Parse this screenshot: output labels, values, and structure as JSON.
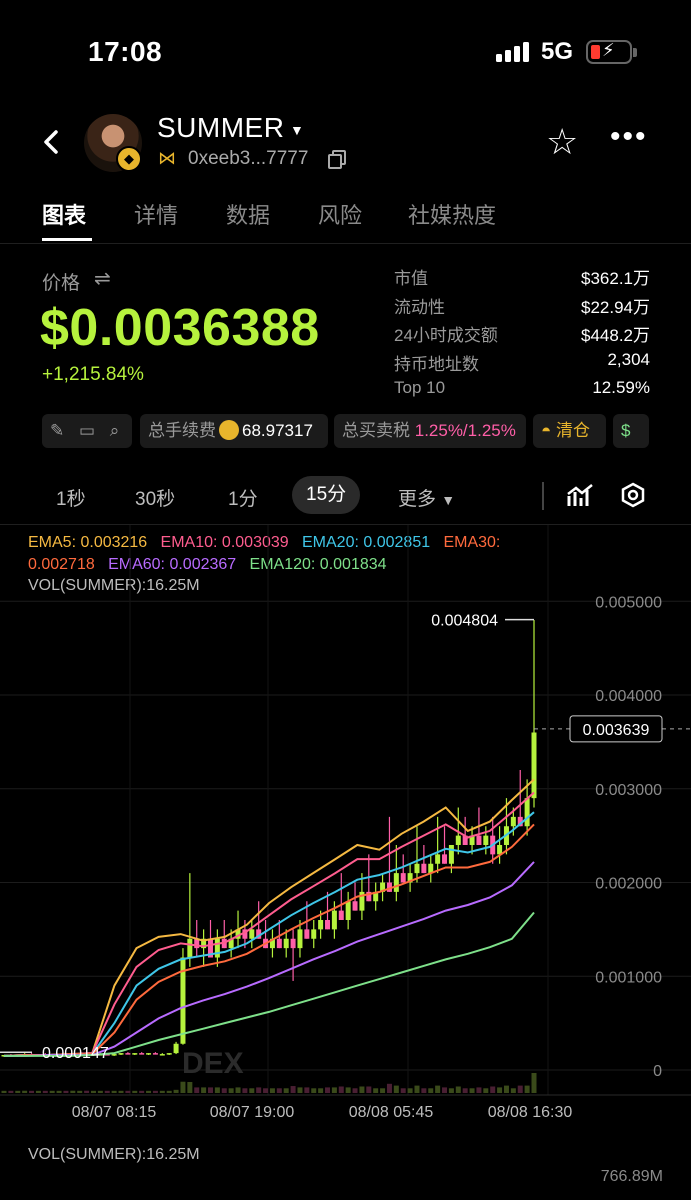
{
  "status_bar": {
    "time": "17:08",
    "network": "5G"
  },
  "header": {
    "token_name": "SUMMER",
    "address": "0xeeb3...7777",
    "icons": [
      "back-icon",
      "caret-down-icon",
      "chain-icon",
      "copy-icon",
      "star-icon",
      "more-icon"
    ]
  },
  "tabs": [
    "图表",
    "详情",
    "数据",
    "风险",
    "社媒热度"
  ],
  "price": {
    "label": "价格",
    "value": "$0.0036388",
    "change": "+1,215.84%"
  },
  "stats": [
    {
      "key": "市值",
      "value": "$362.1万"
    },
    {
      "key": "流动性",
      "value": "$22.94万"
    },
    {
      "key": "24小时成交额",
      "value": "$448.2万"
    },
    {
      "key": "持币地址数",
      "value": "2,304"
    },
    {
      "key": "Top 10",
      "value": "12.59%"
    }
  ],
  "chips": {
    "fee_label": "总手续费",
    "fee_value": "68.97317",
    "tax_label": "总买卖税",
    "tax_value": "1.25%/1.25%",
    "clear_label": "清仓"
  },
  "timeframes": [
    "1秒",
    "30秒",
    "1分",
    "15分",
    "更多"
  ],
  "active_timeframe": "15分",
  "ema": {
    "ema5_label": "EMA5:",
    "ema5": "0.003216",
    "ema10_label": "EMA10:",
    "ema10": "0.003039",
    "ema20_label": "EMA20:",
    "ema20": "0.002851",
    "ema30_label": "EMA30:",
    "ema30": "0.002718",
    "ema60_label": "EMA60:",
    "ema60": "0.002367",
    "ema120_label": "EMA120:",
    "ema120": "0.001834",
    "vol_line": "VOL(SUMMER):16.25M"
  },
  "colors": {
    "up": "#b6f23d",
    "down": "#ff5fa8",
    "ema5": "#f5b942",
    "ema10": "#ff5d8f",
    "ema20": "#3fc6e8",
    "ema30": "#ff6a3d",
    "ema60": "#b86bff",
    "ema120": "#7ee08a"
  },
  "chart_data": {
    "type": "candlestick",
    "y_ticks": [
      "0.005000",
      "0.004000",
      "0.003000",
      "0.002000",
      "0.001000",
      "0"
    ],
    "ylim": [
      0,
      0.0056
    ],
    "x_ticks": [
      "08/07 08:15",
      "08/07 19:00",
      "08/08 05:45",
      "08/08 16:30"
    ],
    "high_marker": "0.004804",
    "low_marker": "0.000147",
    "current_price_tag": "0.003639",
    "watermark": "DEX",
    "series": [
      {
        "name": "EMA5",
        "values": [
          0.00015,
          0.00016,
          0.00016,
          0.00017,
          0.00018,
          0.0009,
          0.0013,
          0.00142,
          0.00145,
          0.00138,
          0.00142,
          0.00155,
          0.00178,
          0.00195,
          0.0021,
          0.00225,
          0.0024,
          0.00235,
          0.00252,
          0.00265,
          0.0028,
          0.00255,
          0.00265,
          0.00288,
          0.0031
        ]
      },
      {
        "name": "EMA10",
        "values": [
          0.00015,
          0.00016,
          0.00016,
          0.00017,
          0.00018,
          0.0007,
          0.0011,
          0.00128,
          0.00135,
          0.00132,
          0.00136,
          0.00148,
          0.00165,
          0.00182,
          0.00196,
          0.0021,
          0.00225,
          0.00225,
          0.00238,
          0.0025,
          0.00262,
          0.00248,
          0.00255,
          0.00275,
          0.00296
        ]
      },
      {
        "name": "EMA20",
        "values": [
          0.00015,
          0.00016,
          0.00016,
          0.00017,
          0.00017,
          0.0005,
          0.0009,
          0.00108,
          0.00118,
          0.00122,
          0.00126,
          0.00135,
          0.0015,
          0.00165,
          0.00178,
          0.0019,
          0.00203,
          0.00208,
          0.00216,
          0.00226,
          0.00236,
          0.00232,
          0.00238,
          0.00255,
          0.00275
        ]
      },
      {
        "name": "EMA30",
        "values": [
          0.00015,
          0.00016,
          0.00016,
          0.00017,
          0.00017,
          0.0004,
          0.00075,
          0.00094,
          0.00105,
          0.00111,
          0.00116,
          0.00124,
          0.00137,
          0.0015,
          0.00162,
          0.00173,
          0.00185,
          0.0019,
          0.00198,
          0.00207,
          0.00216,
          0.00216,
          0.00222,
          0.00238,
          0.00262
        ]
      },
      {
        "name": "EMA60",
        "values": [
          0.00015,
          0.00015,
          0.00016,
          0.00016,
          0.00016,
          0.00025,
          0.0004,
          0.00055,
          0.00066,
          0.00074,
          0.00081,
          0.00089,
          0.00098,
          0.00108,
          0.00118,
          0.00127,
          0.00137,
          0.00145,
          0.00153,
          0.00161,
          0.0017,
          0.00176,
          0.00184,
          0.00197,
          0.00222
        ]
      },
      {
        "name": "EMA120",
        "values": [
          0.00015,
          0.00015,
          0.00015,
          0.00015,
          0.00016,
          0.00018,
          0.00025,
          0.00032,
          0.00038,
          0.00044,
          0.0005,
          0.00056,
          0.00062,
          0.00069,
          0.00076,
          0.00083,
          0.0009,
          0.00097,
          0.00104,
          0.00111,
          0.00118,
          0.00124,
          0.00131,
          0.0014,
          0.00168
        ]
      }
    ],
    "candles": [
      [
        0.00015,
        0.00016,
        0.00014,
        0.00016
      ],
      [
        0.00016,
        0.00017,
        0.00015,
        0.00015
      ],
      [
        0.00015,
        0.00016,
        0.00014,
        0.00016
      ],
      [
        0.00016,
        0.00018,
        0.00015,
        0.00017
      ],
      [
        0.00017,
        0.00018,
        0.00016,
        0.00016
      ],
      [
        0.00016,
        0.00017,
        0.00015,
        0.00017
      ],
      [
        0.00017,
        0.00018,
        0.00016,
        0.00016
      ],
      [
        0.00016,
        0.00017,
        0.00015,
        0.00016
      ],
      [
        0.00016,
        0.00017,
        0.00015,
        0.00017
      ],
      [
        0.00017,
        0.00018,
        0.00016,
        0.00016
      ],
      [
        0.00016,
        0.00018,
        0.00015,
        0.00017
      ],
      [
        0.00017,
        0.00018,
        0.00016,
        0.00017
      ],
      [
        0.00017,
        0.00019,
        0.00016,
        0.00016
      ],
      [
        0.00016,
        0.00017,
        0.00015,
        0.00017
      ],
      [
        0.00017,
        0.00018,
        0.00016,
        0.00017
      ],
      [
        0.00017,
        0.00018,
        0.00016,
        0.00016
      ],
      [
        0.00016,
        0.00017,
        0.00015,
        0.00017
      ],
      [
        0.00017,
        0.00018,
        0.00016,
        0.00018
      ],
      [
        0.00018,
        0.00019,
        0.00017,
        0.00017
      ],
      [
        0.00017,
        0.00018,
        0.00016,
        0.00018
      ],
      [
        0.00018,
        0.00019,
        0.00017,
        0.00017
      ],
      [
        0.00017,
        0.00018,
        0.00016,
        0.00018
      ],
      [
        0.00018,
        0.00019,
        0.00017,
        0.00017
      ],
      [
        0.00017,
        0.00018,
        0.00016,
        0.00017
      ],
      [
        0.00017,
        0.00018,
        0.00016,
        0.00018
      ],
      [
        0.00018,
        0.0003,
        0.00017,
        0.00028
      ],
      [
        0.00028,
        0.0013,
        0.00027,
        0.0012
      ],
      [
        0.0012,
        0.0021,
        0.0011,
        0.0014
      ],
      [
        0.0014,
        0.0016,
        0.0012,
        0.0013
      ],
      [
        0.0013,
        0.0015,
        0.0011,
        0.0014
      ],
      [
        0.0014,
        0.0016,
        0.0012,
        0.0012
      ],
      [
        0.0012,
        0.0015,
        0.0011,
        0.0014
      ],
      [
        0.0014,
        0.0016,
        0.0013,
        0.0013
      ],
      [
        0.0013,
        0.0015,
        0.0012,
        0.0014
      ],
      [
        0.0014,
        0.0017,
        0.0013,
        0.0015
      ],
      [
        0.0015,
        0.0016,
        0.0013,
        0.0014
      ],
      [
        0.0014,
        0.0016,
        0.0013,
        0.0015
      ],
      [
        0.0015,
        0.0018,
        0.0014,
        0.0014
      ],
      [
        0.0014,
        0.0016,
        0.0013,
        0.0013
      ],
      [
        0.0013,
        0.0015,
        0.0012,
        0.0014
      ],
      [
        0.0014,
        0.0016,
        0.0013,
        0.0013
      ],
      [
        0.0013,
        0.0015,
        0.0012,
        0.0014
      ],
      [
        0.0014,
        0.0015,
        0.00095,
        0.0013
      ],
      [
        0.0013,
        0.0016,
        0.0012,
        0.0015
      ],
      [
        0.0015,
        0.0018,
        0.0014,
        0.0014
      ],
      [
        0.0014,
        0.0016,
        0.0013,
        0.0015
      ],
      [
        0.0015,
        0.0017,
        0.0014,
        0.0016
      ],
      [
        0.0016,
        0.0019,
        0.0015,
        0.0015
      ],
      [
        0.0015,
        0.0018,
        0.0014,
        0.0017
      ],
      [
        0.0017,
        0.0021,
        0.0016,
        0.0016
      ],
      [
        0.0016,
        0.0019,
        0.0015,
        0.0018
      ],
      [
        0.0018,
        0.002,
        0.0017,
        0.0017
      ],
      [
        0.0017,
        0.0021,
        0.0016,
        0.0019
      ],
      [
        0.0019,
        0.0023,
        0.0018,
        0.0018
      ],
      [
        0.0018,
        0.002,
        0.0017,
        0.0019
      ],
      [
        0.0019,
        0.0021,
        0.0018,
        0.002
      ],
      [
        0.002,
        0.0027,
        0.0019,
        0.0019
      ],
      [
        0.0019,
        0.0024,
        0.0018,
        0.0021
      ],
      [
        0.0021,
        0.0023,
        0.002,
        0.002
      ],
      [
        0.002,
        0.0022,
        0.0019,
        0.0021
      ],
      [
        0.0021,
        0.0026,
        0.002,
        0.0022
      ],
      [
        0.0022,
        0.0024,
        0.0021,
        0.0021
      ],
      [
        0.0021,
        0.0023,
        0.002,
        0.0022
      ],
      [
        0.0022,
        0.0027,
        0.0021,
        0.0023
      ],
      [
        0.0023,
        0.0026,
        0.0022,
        0.0022
      ],
      [
        0.0022,
        0.0024,
        0.0021,
        0.0024
      ],
      [
        0.0024,
        0.0028,
        0.0023,
        0.0025
      ],
      [
        0.0025,
        0.0027,
        0.0024,
        0.0024
      ],
      [
        0.0024,
        0.0026,
        0.0023,
        0.0025
      ],
      [
        0.0025,
        0.0028,
        0.0024,
        0.0024
      ],
      [
        0.0024,
        0.0026,
        0.0023,
        0.0025
      ],
      [
        0.0025,
        0.0027,
        0.0022,
        0.0023
      ],
      [
        0.0023,
        0.0026,
        0.0022,
        0.0024
      ],
      [
        0.0024,
        0.0029,
        0.0023,
        0.0026
      ],
      [
        0.0026,
        0.0028,
        0.0025,
        0.0027
      ],
      [
        0.0027,
        0.0032,
        0.0026,
        0.0026
      ],
      [
        0.0026,
        0.0031,
        0.0025,
        0.0029
      ],
      [
        0.0029,
        0.0048,
        0.0028,
        0.0036
      ]
    ]
  }
}
